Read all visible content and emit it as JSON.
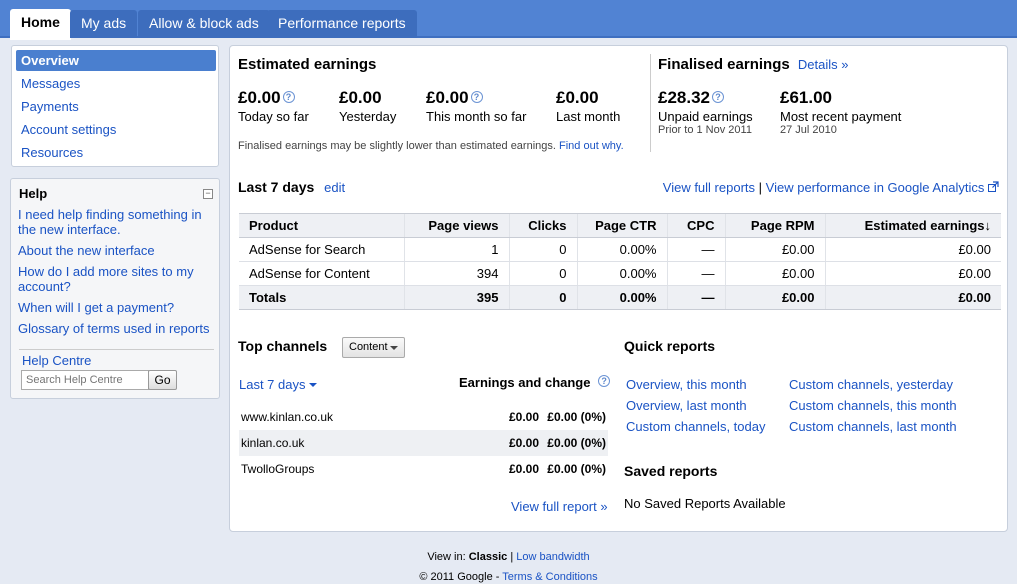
{
  "tabs": [
    "Home",
    "My ads",
    "Allow & block ads",
    "Performance reports"
  ],
  "nav": [
    "Overview",
    "Messages",
    "Payments",
    "Account settings",
    "Resources"
  ],
  "help": {
    "title": "Help",
    "collapse_symbol": "−",
    "links": [
      "I need help finding something in the new interface.",
      "About the new interface",
      "How do I add more sites to my account?",
      "When will I get a payment?",
      "Glossary of terms used in reports"
    ],
    "centre_label": "Help Centre",
    "search_placeholder": "Search Help Centre",
    "go_label": "Go"
  },
  "estimated": {
    "title": "Estimated earnings",
    "items": [
      {
        "value": "£0.00",
        "label": "Today so far",
        "help": true
      },
      {
        "value": "£0.00",
        "label": "Yesterday",
        "help": false
      },
      {
        "value": "£0.00",
        "label": "This month so far",
        "help": true
      },
      {
        "value": "£0.00",
        "label": "Last month",
        "help": false
      }
    ],
    "note": "Finalised earnings may be slightly lower than estimated earnings.",
    "note_link": "Find out why."
  },
  "finalised": {
    "title": "Finalised earnings",
    "details_link": "Details »",
    "unpaid_value": "£28.32",
    "unpaid_label": "Unpaid earnings",
    "unpaid_sub": "Prior to 1 Nov 2011",
    "payment_value": "£61.00",
    "payment_label": "Most recent payment",
    "payment_sub": "27 Jul 2010"
  },
  "last7": {
    "title": "Last 7 days",
    "edit_link": "edit",
    "view_full_link": "View full reports",
    "sep": "|",
    "analytics_link": "View performance in Google Analytics"
  },
  "table": {
    "headers": [
      "Product",
      "Page views",
      "Clicks",
      "Page CTR",
      "CPC",
      "Page RPM",
      "Estimated earnings"
    ],
    "sort_indicator": "↓",
    "rows": [
      [
        "AdSense for Search",
        "1",
        "0",
        "0.00%",
        "—",
        "£0.00",
        "£0.00"
      ],
      [
        "AdSense for Content",
        "394",
        "0",
        "0.00%",
        "—",
        "£0.00",
        "£0.00"
      ]
    ],
    "totals": [
      "Totals",
      "395",
      "0",
      "0.00%",
      "—",
      "£0.00",
      "£0.00"
    ]
  },
  "channels": {
    "title": "Top channels",
    "type_select": "Content",
    "range_select": "Last 7 days",
    "earnings_header": "Earnings and change",
    "rows": [
      {
        "name": "www.kinlan.co.uk",
        "earnings": "£0.00",
        "change": "£0.00 (0%)"
      },
      {
        "name": "kinlan.co.uk",
        "earnings": "£0.00",
        "change": "£0.00 (0%)"
      },
      {
        "name": "TwolloGroups",
        "earnings": "£0.00",
        "change": "£0.00 (0%)"
      }
    ],
    "view_full_link": "View full report »"
  },
  "quick_reports": {
    "title": "Quick reports",
    "col1": [
      "Overview, this month",
      "Overview, last month",
      "Custom channels, today"
    ],
    "col2": [
      "Custom channels, yesterday",
      "Custom channels, this month",
      "Custom channels, last month"
    ]
  },
  "saved_reports": {
    "title": "Saved reports",
    "empty_text": "No Saved Reports Available"
  },
  "footer": {
    "view_in_label": "View in:",
    "classic": "Classic",
    "sep": "|",
    "low_bandwidth": "Low bandwidth",
    "copyright": "© 2011 Google",
    "dash": "-",
    "terms": "Terms & Conditions"
  },
  "colors": {
    "tab_bar": "#5183d3",
    "nav_selected": "#4a7fcf",
    "link": "#1a53c4"
  }
}
